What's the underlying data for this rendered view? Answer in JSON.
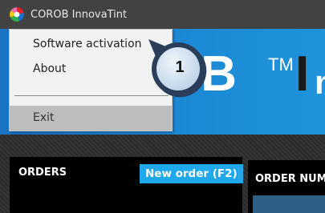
{
  "window": {
    "title": "COROB InnovaTint"
  },
  "menu": {
    "items": [
      {
        "label": "Software activation"
      },
      {
        "label": "About"
      },
      {
        "label": "Exit"
      }
    ]
  },
  "banner": {
    "brand_text": "OB",
    "trademark": "TM",
    "tail_text": "I",
    "tail_text2": "n"
  },
  "orders_panel": {
    "title": "ORDERS",
    "new_order_label": "New order (F2)"
  },
  "order_number_panel": {
    "title": "ORDER NUM"
  },
  "callout": {
    "number": "1"
  },
  "colors": {
    "title_bar": "#424242",
    "banner_blue": "#1c8ad6",
    "button_blue": "#1fa8ec",
    "callout_fill": "#cfe0f0",
    "callout_border": "#2a3d59"
  },
  "icons": {
    "app_logo": "corob-logo-icon"
  }
}
